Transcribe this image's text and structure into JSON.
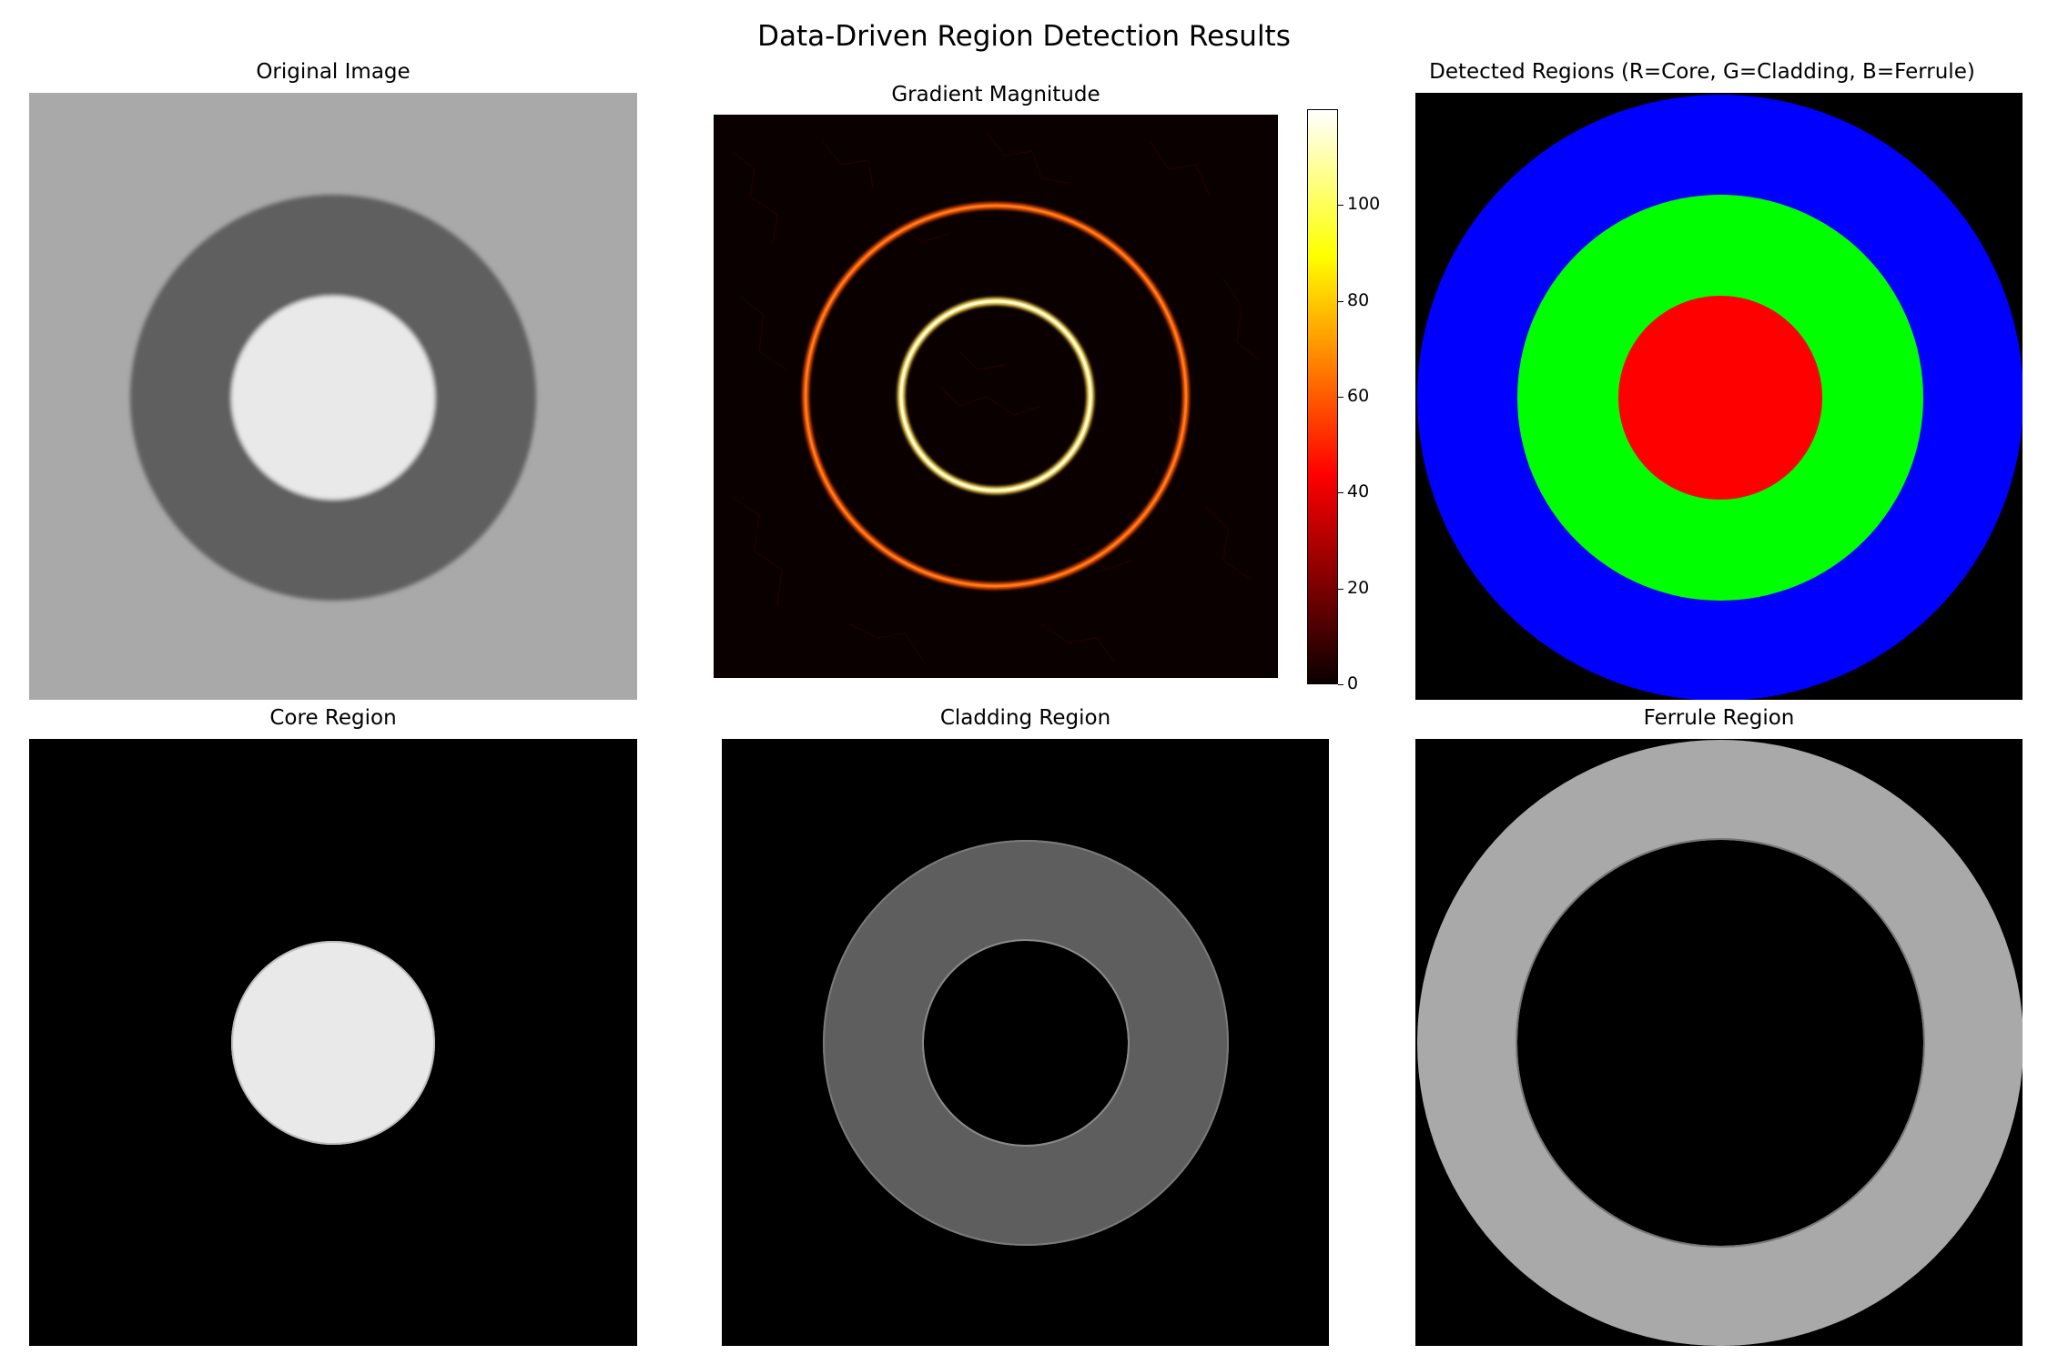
{
  "figure": {
    "title": "Data-Driven Region Detection Results"
  },
  "panels": [
    {
      "id": "original",
      "title": "Original Image"
    },
    {
      "id": "gradient",
      "title": "Gradient Magnitude"
    },
    {
      "id": "detected",
      "title": "Detected Regions (R=Core, G=Cladding, B=Ferrule)"
    },
    {
      "id": "core",
      "title": "Core Region"
    },
    {
      "id": "cladding",
      "title": "Cladding Region"
    },
    {
      "id": "ferrule",
      "title": "Ferrule Region"
    }
  ],
  "colorbar": {
    "ticks": [
      "0",
      "20",
      "40",
      "60",
      "80",
      "100"
    ],
    "range": [
      0,
      120
    ],
    "colormap": "hot"
  },
  "colors": {
    "background_gray": "#a9a9a9",
    "cladding_gray": "#5e5e5e",
    "core_white": "#e9e9e9",
    "core_red": "#ff0000",
    "cladding_green": "#00ff00",
    "ferrule_blue": "#0000ff"
  },
  "chart_data": {
    "type": "heatmap",
    "images": 6,
    "gradient_rings": [
      {
        "name": "core boundary",
        "magnitude": 110
      },
      {
        "name": "cladding boundary",
        "magnitude": 65
      }
    ],
    "colorbar_range": [
      0,
      120
    ]
  }
}
